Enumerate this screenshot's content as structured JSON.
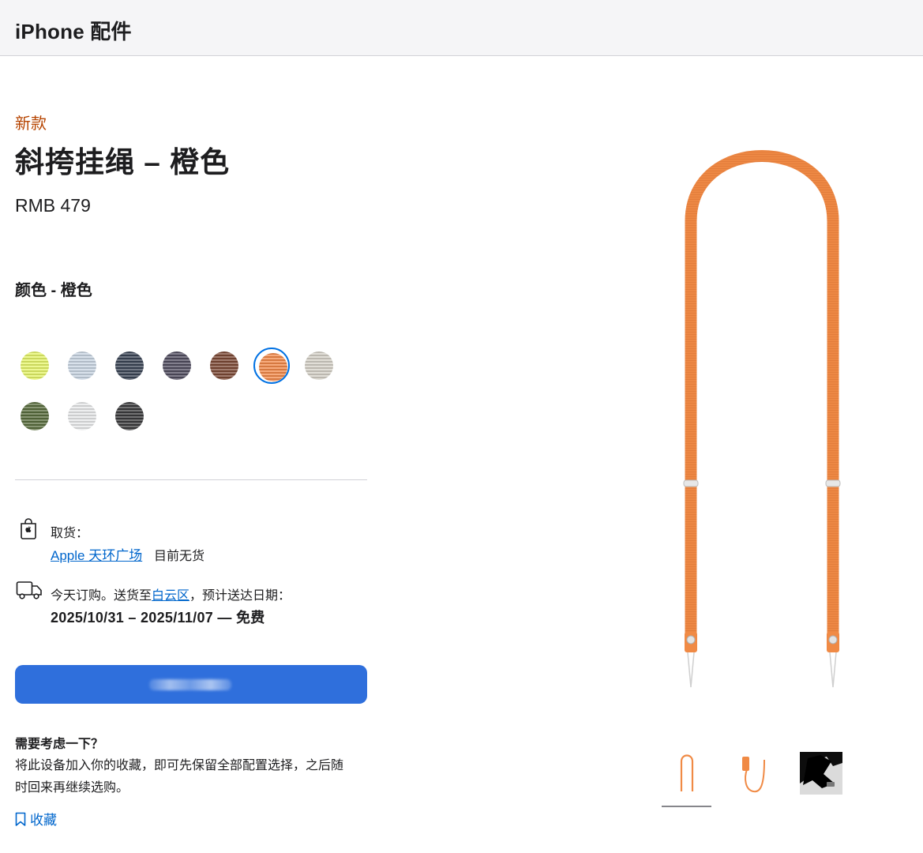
{
  "header": {
    "title": "iPhone 配件"
  },
  "product": {
    "badge": "新款",
    "name": "斜挎挂绳 – 橙色",
    "price": "RMB 479",
    "color_label": "颜色 - 橙色",
    "selected_color_index": 5,
    "swatches": [
      {
        "name": "neon-yellow",
        "color": "#e6f56a"
      },
      {
        "name": "light-blue",
        "color": "#c9d6e3"
      },
      {
        "name": "navy",
        "color": "#3b4556"
      },
      {
        "name": "purple-gray",
        "color": "#524e61"
      },
      {
        "name": "brown",
        "color": "#7d4a36"
      },
      {
        "name": "orange",
        "color": "#f38a4a"
      },
      {
        "name": "stone",
        "color": "#d6d2c8"
      },
      {
        "name": "green",
        "color": "#5a6e3f"
      },
      {
        "name": "white",
        "color": "#e8e9ea"
      },
      {
        "name": "black",
        "color": "#3b3b3d"
      }
    ]
  },
  "pickup": {
    "label": "取货：",
    "store": "Apple 天环广场",
    "status": "目前无货"
  },
  "shipping": {
    "prefix": "今天订购。送货至",
    "district": "白云区",
    "suffix": "，预计送达日期：",
    "dates": "2025/10/31 – 2025/11/07 — 免费"
  },
  "consider": {
    "title": "需要考虑一下？",
    "text": "将此设备加入你的收藏，即可先保留全部配置选择，之后随时回来再继续选购。",
    "save_label": "收藏"
  },
  "colors": {
    "accent": "#0071e3",
    "button": "#2f6fdc",
    "badge": "#b64400",
    "link": "#0066cc",
    "strap": "#f08a45"
  }
}
